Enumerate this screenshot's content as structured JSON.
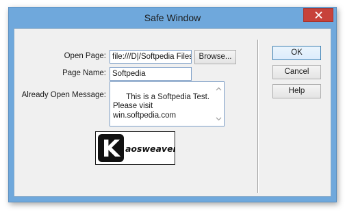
{
  "window": {
    "title": "Safe Window"
  },
  "form": {
    "open_page_label": "Open Page:",
    "open_page_value": "file:///D|/Softpedia Files",
    "browse_label": "Browse...",
    "page_name_label": "Page Name:",
    "page_name_value": "Softpedia",
    "message_label": "Already Open Message:",
    "message_value": "This is a Softpedia Test.\nPlease visit\nwin.softpedia.com"
  },
  "buttons": {
    "ok": "OK",
    "cancel": "Cancel",
    "help": "Help"
  },
  "logo": {
    "letter": "K",
    "text": "aosweaver"
  },
  "colors": {
    "titlebar": "#6fa8dc",
    "close": "#c7423a",
    "dialog_bg": "#f0f0f0"
  }
}
